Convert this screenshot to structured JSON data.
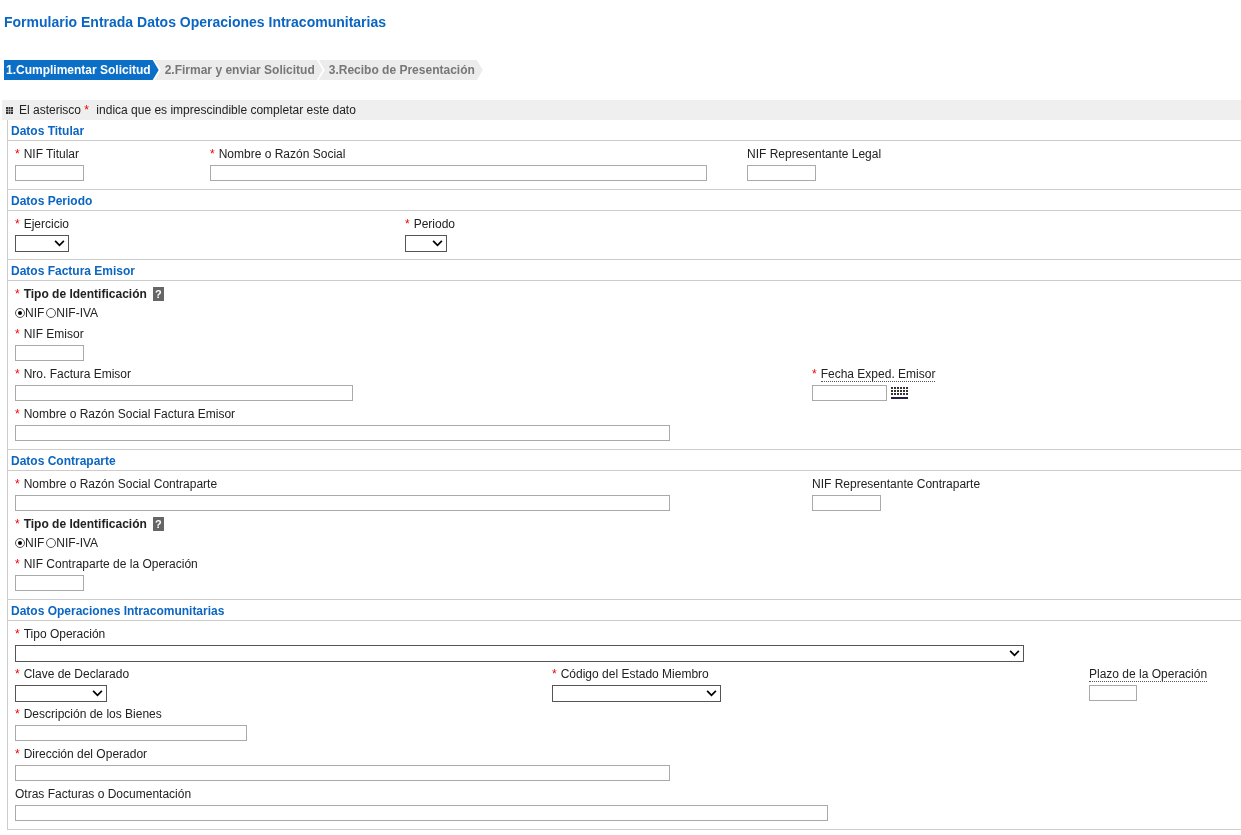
{
  "title": "Formulario Entrada Datos Operaciones Intracomunitarias",
  "steps": [
    {
      "label": "1.Cumplimentar Solicitud",
      "selected": true
    },
    {
      "label": "2.Firmar y enviar Solicitud",
      "selected": false
    },
    {
      "label": "3.Recibo de Presentación",
      "selected": false
    }
  ],
  "notice": {
    "before": "El asterisco",
    "mark": "*",
    "after": "indica que es imprescindible completar este dato"
  },
  "sections": [
    {
      "title": "Datos Titular",
      "rows": [
        [
          {
            "kind": "text",
            "label": "NIF Titular",
            "required": true
          },
          {
            "kind": "text",
            "label": "Nombre o Razón Social",
            "required": true
          },
          {
            "kind": "text",
            "label": "NIF Representante Legal",
            "required": false
          }
        ]
      ]
    },
    {
      "title": "Datos Periodo",
      "rows": [
        [
          {
            "kind": "select",
            "label": "Ejercicio",
            "required": true
          },
          {
            "kind": "select",
            "label": "Periodo",
            "required": true
          }
        ]
      ]
    },
    {
      "title": "Datos Factura Emisor",
      "rows": [
        [
          {
            "kind": "radio",
            "label": "Tipo de Identificación",
            "required": true,
            "help": "?",
            "options": [
              {
                "label": "NIF",
                "selected": true
              },
              {
                "label": "NIF-IVA",
                "selected": false
              }
            ]
          }
        ],
        [
          {
            "kind": "text",
            "label": "NIF Emisor",
            "required": true
          }
        ],
        [
          {
            "kind": "text",
            "label": "Nro. Factura Emisor",
            "required": true
          },
          {
            "kind": "date",
            "label": "Fecha Exped. Emisor",
            "required": true,
            "hint": true
          }
        ],
        [
          {
            "kind": "text",
            "label": "Nombre o Razón Social Factura Emisor",
            "required": true
          }
        ]
      ]
    },
    {
      "title": "Datos Contraparte",
      "rows": [
        [
          {
            "kind": "text",
            "label": "Nombre o Razón Social Contraparte",
            "required": true
          },
          {
            "kind": "text",
            "label": "NIF Representante Contraparte",
            "required": false
          }
        ],
        [
          {
            "kind": "radio",
            "label": "Tipo de Identificación",
            "required": true,
            "help": "?",
            "options": [
              {
                "label": "NIF",
                "selected": true
              },
              {
                "label": "NIF-IVA",
                "selected": false
              }
            ]
          }
        ],
        [
          {
            "kind": "text",
            "label": "NIF Contraparte de la Operación",
            "required": true
          }
        ]
      ]
    },
    {
      "title": "Datos Operaciones Intracomunitarias",
      "rows": [
        [
          {
            "kind": "select",
            "label": "Tipo Operación",
            "required": true
          }
        ],
        [
          {
            "kind": "select",
            "label": "Clave de Declarado",
            "required": true
          },
          {
            "kind": "select",
            "label": "Código del Estado Miembro",
            "required": true
          },
          {
            "kind": "text",
            "label": "Plazo de la Operación",
            "required": false,
            "hint": true
          }
        ],
        [
          {
            "kind": "text",
            "label": "Descripción de los Bienes",
            "required": true
          }
        ],
        [
          {
            "kind": "text",
            "label": "Dirección del Operador",
            "required": true
          }
        ],
        [
          {
            "kind": "text",
            "label": "Otras Facturas o Documentación",
            "required": false
          }
        ]
      ]
    }
  ]
}
